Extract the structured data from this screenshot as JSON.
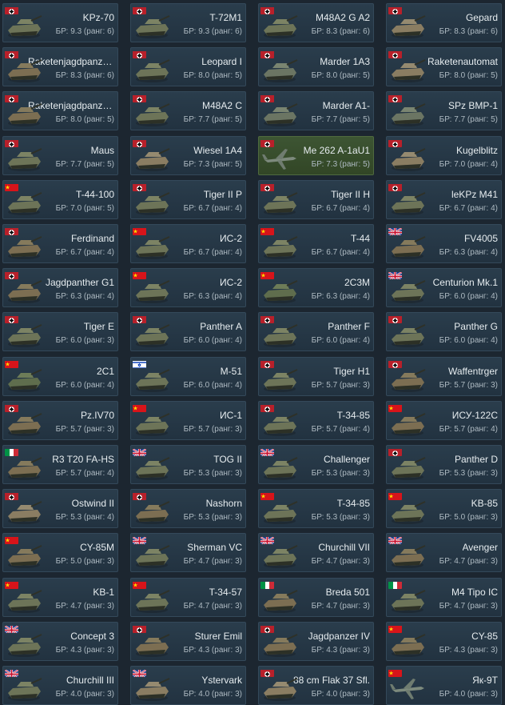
{
  "tiles": [
    {
      "name": "KPz-70",
      "br": "БР: 9.3 (ранг: 6)",
      "flag": "de",
      "icon": "tank-icon"
    },
    {
      "name": "T-72M1",
      "br": "БР: 9.3 (ранг: 6)",
      "flag": "de",
      "icon": "tank-icon"
    },
    {
      "name": "M48A2 G A2",
      "br": "БР: 8.3 (ранг: 6)",
      "flag": "de",
      "icon": "tank-icon"
    },
    {
      "name": "Gepard",
      "br": "БР: 8.3 (ранг: 6)",
      "flag": "de",
      "icon": "spaa-icon"
    },
    {
      "name": "Raketenjagdpanze...",
      "br": "БР: 8.3 (ранг: 6)",
      "flag": "de",
      "icon": "tank-destroyer-icon"
    },
    {
      "name": "Leopard I",
      "br": "БР: 8.0 (ранг: 5)",
      "flag": "de",
      "icon": "tank-icon"
    },
    {
      "name": "Marder 1A3",
      "br": "БР: 8.0 (ранг: 5)",
      "flag": "de",
      "icon": "ifv-icon"
    },
    {
      "name": "Raketenautomat",
      "br": "БР: 8.0 (ранг: 5)",
      "flag": "de",
      "icon": "spaa-icon"
    },
    {
      "name": "Raketenjagdpanze...",
      "br": "БР: 8.0 (ранг: 5)",
      "flag": "de",
      "icon": "tank-destroyer-icon"
    },
    {
      "name": "M48A2 C",
      "br": "БР: 7.7 (ранг: 5)",
      "flag": "de",
      "icon": "tank-icon"
    },
    {
      "name": "Marder A1-",
      "br": "БР: 7.7 (ранг: 5)",
      "flag": "de",
      "icon": "ifv-icon"
    },
    {
      "name": "SPz BMP-1",
      "br": "БР: 7.7 (ранг: 5)",
      "flag": "de",
      "icon": "ifv-icon"
    },
    {
      "name": "Maus",
      "br": "БР: 7.7 (ранг: 5)",
      "flag": "de",
      "icon": "tank-icon"
    },
    {
      "name": "Wiesel 1A4",
      "br": "БР: 7.3 (ранг: 5)",
      "flag": "de",
      "icon": "spaa-icon"
    },
    {
      "name": "Me 262 A-1aU1",
      "br": "БР: 7.3 (ранг: 5)",
      "flag": "de",
      "icon": "aircraft-icon",
      "highlight": true
    },
    {
      "name": "Kugelblitz",
      "br": "БР: 7.0 (ранг: 4)",
      "flag": "de",
      "icon": "spaa-icon"
    },
    {
      "name": "T-44-100",
      "br": "БР: 7.0 (ранг: 5)",
      "flag": "cn",
      "icon": "tank-icon"
    },
    {
      "name": "Tiger II P",
      "br": "БР: 6.7 (ранг: 4)",
      "flag": "de",
      "icon": "tank-icon"
    },
    {
      "name": "Tiger II H",
      "br": "БР: 6.7 (ранг: 4)",
      "flag": "de",
      "icon": "tank-icon"
    },
    {
      "name": "leKPz M41",
      "br": "БР: 6.7 (ранг: 4)",
      "flag": "de",
      "icon": "tank-icon"
    },
    {
      "name": "Ferdinand",
      "br": "БР: 6.7 (ранг: 4)",
      "flag": "de",
      "icon": "tank-destroyer-icon"
    },
    {
      "name": "ИС-2",
      "br": "БР: 6.7 (ранг: 4)",
      "flag": "cn",
      "icon": "tank-icon"
    },
    {
      "name": "T-44",
      "br": "БР: 6.7 (ранг: 4)",
      "flag": "cn",
      "icon": "tank-icon"
    },
    {
      "name": "FV4005",
      "br": "БР: 6.3 (ранг: 4)",
      "flag": "uk",
      "icon": "tank-destroyer-icon"
    },
    {
      "name": "Jagdpanther G1",
      "br": "БР: 6.3 (ранг: 4)",
      "flag": "de",
      "icon": "tank-destroyer-icon"
    },
    {
      "name": "ИС-2",
      "br": "БР: 6.3 (ранг: 4)",
      "flag": "cn",
      "icon": "tank-icon"
    },
    {
      "name": "2С3М",
      "br": "БР: 6.3 (ранг: 4)",
      "flag": "cn",
      "icon": "artillery-icon"
    },
    {
      "name": "Centurion Mk.1",
      "br": "БР: 6.0 (ранг: 4)",
      "flag": "uk",
      "icon": "tank-icon"
    },
    {
      "name": "Tiger E",
      "br": "БР: 6.0 (ранг: 3)",
      "flag": "de",
      "icon": "tank-icon"
    },
    {
      "name": "Panther A",
      "br": "БР: 6.0 (ранг: 4)",
      "flag": "de",
      "icon": "tank-icon"
    },
    {
      "name": "Panther F",
      "br": "БР: 6.0 (ранг: 4)",
      "flag": "de",
      "icon": "tank-icon"
    },
    {
      "name": "Panther G",
      "br": "БР: 6.0 (ранг: 4)",
      "flag": "de",
      "icon": "tank-icon"
    },
    {
      "name": "2C1",
      "br": "БР: 6.0 (ранг: 4)",
      "flag": "cn",
      "icon": "artillery-icon"
    },
    {
      "name": "M-51",
      "br": "БР: 6.0 (ранг: 4)",
      "flag": "il",
      "icon": "tank-icon"
    },
    {
      "name": "Tiger H1",
      "br": "БР: 5.7 (ранг: 3)",
      "flag": "de",
      "icon": "tank-icon"
    },
    {
      "name": "Waffentrger",
      "br": "БР: 5.7 (ранг: 3)",
      "flag": "de",
      "icon": "tank-destroyer-icon"
    },
    {
      "name": "Pz.IV70",
      "br": "БР: 5.7 (ранг: 3)",
      "flag": "de",
      "icon": "tank-destroyer-icon"
    },
    {
      "name": "ИС-1",
      "br": "БР: 5.7 (ранг: 3)",
      "flag": "cn",
      "icon": "tank-icon"
    },
    {
      "name": "T-34-85",
      "br": "БР: 5.7 (ранг: 4)",
      "flag": "de",
      "icon": "tank-icon"
    },
    {
      "name": "ИСУ-122С",
      "br": "БР: 5.7 (ранг: 4)",
      "flag": "cn",
      "icon": "tank-destroyer-icon"
    },
    {
      "name": "R3 T20 FA-HS",
      "br": "БР: 5.7 (ранг: 4)",
      "flag": "it",
      "icon": "tank-destroyer-icon"
    },
    {
      "name": "TOG II",
      "br": "БР: 5.3 (ранг: 3)",
      "flag": "uk",
      "icon": "tank-icon"
    },
    {
      "name": "Challenger",
      "br": "БР: 5.3 (ранг: 3)",
      "flag": "uk",
      "icon": "tank-icon"
    },
    {
      "name": "Panther D",
      "br": "БР: 5.3 (ранг: 3)",
      "flag": "de",
      "icon": "tank-icon"
    },
    {
      "name": "Ostwind II",
      "br": "БР: 5.3 (ранг: 4)",
      "flag": "de",
      "icon": "spaa-icon"
    },
    {
      "name": "Nashorn",
      "br": "БР: 5.3 (ранг: 3)",
      "flag": "de",
      "icon": "tank-destroyer-icon"
    },
    {
      "name": "T-34-85",
      "br": "БР: 5.3 (ранг: 3)",
      "flag": "cn",
      "icon": "tank-icon"
    },
    {
      "name": "KB-85",
      "br": "БР: 5.0 (ранг: 3)",
      "flag": "cn",
      "icon": "tank-icon"
    },
    {
      "name": "CY-85M",
      "br": "БР: 5.0 (ранг: 3)",
      "flag": "cn",
      "icon": "tank-destroyer-icon"
    },
    {
      "name": "Sherman VC",
      "br": "БР: 4.7 (ранг: 3)",
      "flag": "uk",
      "icon": "tank-icon"
    },
    {
      "name": "Churchill VII",
      "br": "БР: 4.7 (ранг: 3)",
      "flag": "uk",
      "icon": "tank-icon"
    },
    {
      "name": "Avenger",
      "br": "БР: 4.7 (ранг: 3)",
      "flag": "uk",
      "icon": "tank-destroyer-icon"
    },
    {
      "name": "KB-1",
      "br": "БР: 4.7 (ранг: 3)",
      "flag": "cn",
      "icon": "tank-icon"
    },
    {
      "name": "T-34-57",
      "br": "БР: 4.7 (ранг: 3)",
      "flag": "cn",
      "icon": "tank-icon"
    },
    {
      "name": "Breda 501",
      "br": "БР: 4.7 (ранг: 3)",
      "flag": "it",
      "icon": "tank-destroyer-icon"
    },
    {
      "name": "M4 Tipo IC",
      "br": "БР: 4.7 (ранг: 3)",
      "flag": "it",
      "icon": "tank-icon"
    },
    {
      "name": "Concept 3",
      "br": "БР: 4.3 (ранг: 3)",
      "flag": "uk",
      "icon": "tank-icon"
    },
    {
      "name": "Sturer Emil",
      "br": "БР: 4.3 (ранг: 3)",
      "flag": "de",
      "icon": "tank-destroyer-icon"
    },
    {
      "name": "Jagdpanzer IV",
      "br": "БР: 4.3 (ранг: 3)",
      "flag": "de",
      "icon": "tank-destroyer-icon"
    },
    {
      "name": "CY-85",
      "br": "БР: 4.3 (ранг: 3)",
      "flag": "cn",
      "icon": "tank-destroyer-icon"
    },
    {
      "name": "Churchill III",
      "br": "БР: 4.0 (ранг: 3)",
      "flag": "uk",
      "icon": "tank-icon"
    },
    {
      "name": "Ystervark",
      "br": "БР: 4.0 (ранг: 3)",
      "flag": "uk",
      "icon": "spaa-icon"
    },
    {
      "name": "88 cm Flak 37 Sfl.",
      "br": "БР: 4.0 (ранг: 3)",
      "flag": "de",
      "icon": "spaa-icon"
    },
    {
      "name": "Як-9Т",
      "br": "БР: 4.0 (ранг: 3)",
      "flag": "cn",
      "icon": "aircraft-icon"
    }
  ],
  "colors": {
    "card_bg": "#263846",
    "card_highlight": "#3d5533",
    "name_text": "#e6ecef",
    "br_text": "#aebac2"
  }
}
